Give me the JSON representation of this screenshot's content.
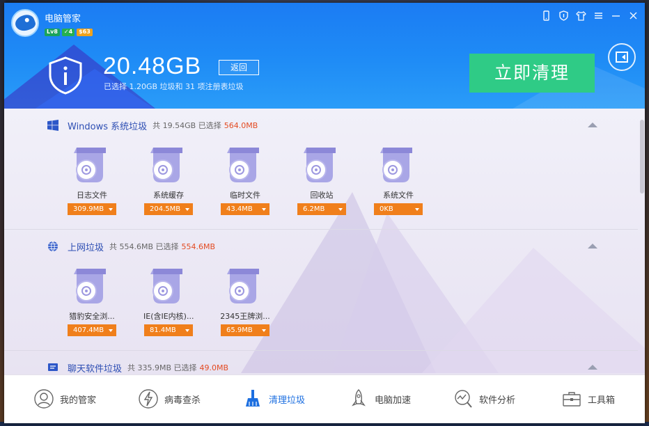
{
  "app": {
    "title": "电脑管家",
    "badges": [
      "Lv8",
      "✓4",
      "$63"
    ]
  },
  "header": {
    "total_size": "20.48GB",
    "back_label": "返回",
    "subtitle": "已选择 1.20GB 垃圾和 31 项注册表垃圾",
    "clean_button": "立即清理"
  },
  "sections": [
    {
      "name": "Windows 系统垃圾",
      "stat": "共 19.54GB 已选择",
      "selected": "564.0MB",
      "icon": "windows-icon",
      "items": [
        {
          "label": "日志文件",
          "size": "309.9MB"
        },
        {
          "label": "系统缓存",
          "size": "204.5MB"
        },
        {
          "label": "临时文件",
          "size": "43.4MB"
        },
        {
          "label": "回收站",
          "size": "6.2MB"
        },
        {
          "label": "系统文件",
          "size": "0KB"
        }
      ]
    },
    {
      "name": "上网垃圾",
      "stat": "共 554.6MB 已选择",
      "selected": "554.6MB",
      "icon": "globe-icon",
      "items": [
        {
          "label": "猎豹安全浏...",
          "size": "407.4MB"
        },
        {
          "label": "IE(含IE内核)...",
          "size": "81.4MB"
        },
        {
          "label": "2345王牌浏...",
          "size": "65.9MB"
        }
      ]
    },
    {
      "name": "聊天软件垃圾",
      "stat": "共 335.9MB 已选择",
      "selected": "49.0MB",
      "icon": "chat-icon",
      "items": []
    }
  ],
  "bottom_nav": [
    {
      "label": "我的管家",
      "icon": "butler-icon"
    },
    {
      "label": "病毒查杀",
      "icon": "lightning-shield-icon"
    },
    {
      "label": "清理垃圾",
      "icon": "broom-icon"
    },
    {
      "label": "电脑加速",
      "icon": "rocket-icon"
    },
    {
      "label": "软件分析",
      "icon": "magnifier-chart-icon"
    },
    {
      "label": "工具箱",
      "icon": "toolbox-icon"
    }
  ],
  "colors": {
    "header_blue": "#1f8cf6",
    "clean_green": "#2fcb86",
    "size_orange": "#f07f1b",
    "selected_red": "#e34b22",
    "active_nav": "#1d6fe0"
  }
}
